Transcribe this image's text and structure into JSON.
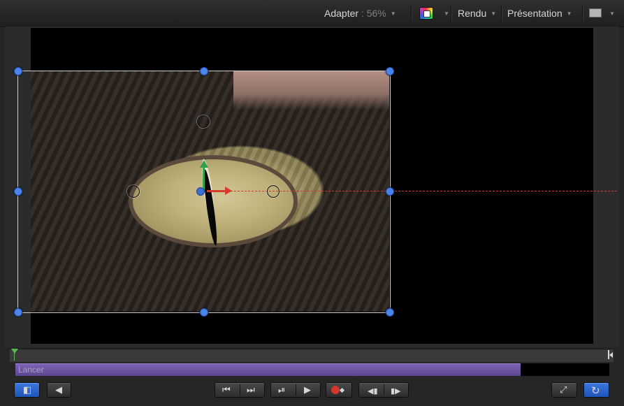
{
  "toolbar": {
    "fit_label": "Adapter",
    "fit_value": ": 56%",
    "render_label": "Rendu",
    "view_label": "Présentation"
  },
  "canvas": {
    "background_color": "#000000",
    "image_subject": "crocodile-eye"
  },
  "timeline": {
    "clip_label": "Lancer",
    "clip_color": "#6a52a3",
    "clip_fill_fraction": 0.85
  },
  "controls": {
    "icons": [
      "layers-toggle-icon",
      "audio-icon",
      "go-to-start-icon",
      "go-to-end-icon",
      "play-from-start-icon",
      "play-icon",
      "record-keyframe-icon",
      "previous-keyframe-icon",
      "next-keyframe-icon",
      "fullscreen-icon",
      "loop-icon"
    ],
    "accent_color": "#2f6bd6"
  }
}
